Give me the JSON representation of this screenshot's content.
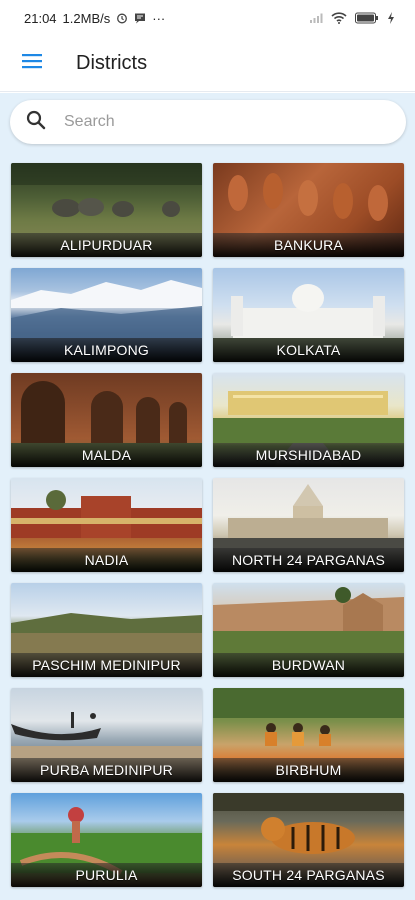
{
  "status_bar": {
    "time": "21:04",
    "network_speed": "1.2MB/s",
    "more": "···"
  },
  "app_bar": {
    "title": "Districts",
    "menu_icon": "hamburger-menu-icon"
  },
  "search": {
    "placeholder": "Search",
    "value": "",
    "icon": "search-icon"
  },
  "districts": [
    {
      "name": "ALIPURDUAR"
    },
    {
      "name": "BANKURA"
    },
    {
      "name": "KALIMPONG"
    },
    {
      "name": "KOLKATA"
    },
    {
      "name": "MALDA"
    },
    {
      "name": "MURSHIDABAD"
    },
    {
      "name": "NADIA"
    },
    {
      "name": "NORTH 24 PARGANAS"
    },
    {
      "name": "PASCHIM MEDINIPUR"
    },
    {
      "name": "BURDWAN"
    },
    {
      "name": "PURBA MEDINIPUR"
    },
    {
      "name": "BIRBHUM"
    },
    {
      "name": "PURULIA"
    },
    {
      "name": "SOUTH 24 PARGANAS"
    }
  ],
  "colors": {
    "accent": "#1e88e5",
    "background": "#e3f0fa",
    "label_text": "#ffffff"
  }
}
